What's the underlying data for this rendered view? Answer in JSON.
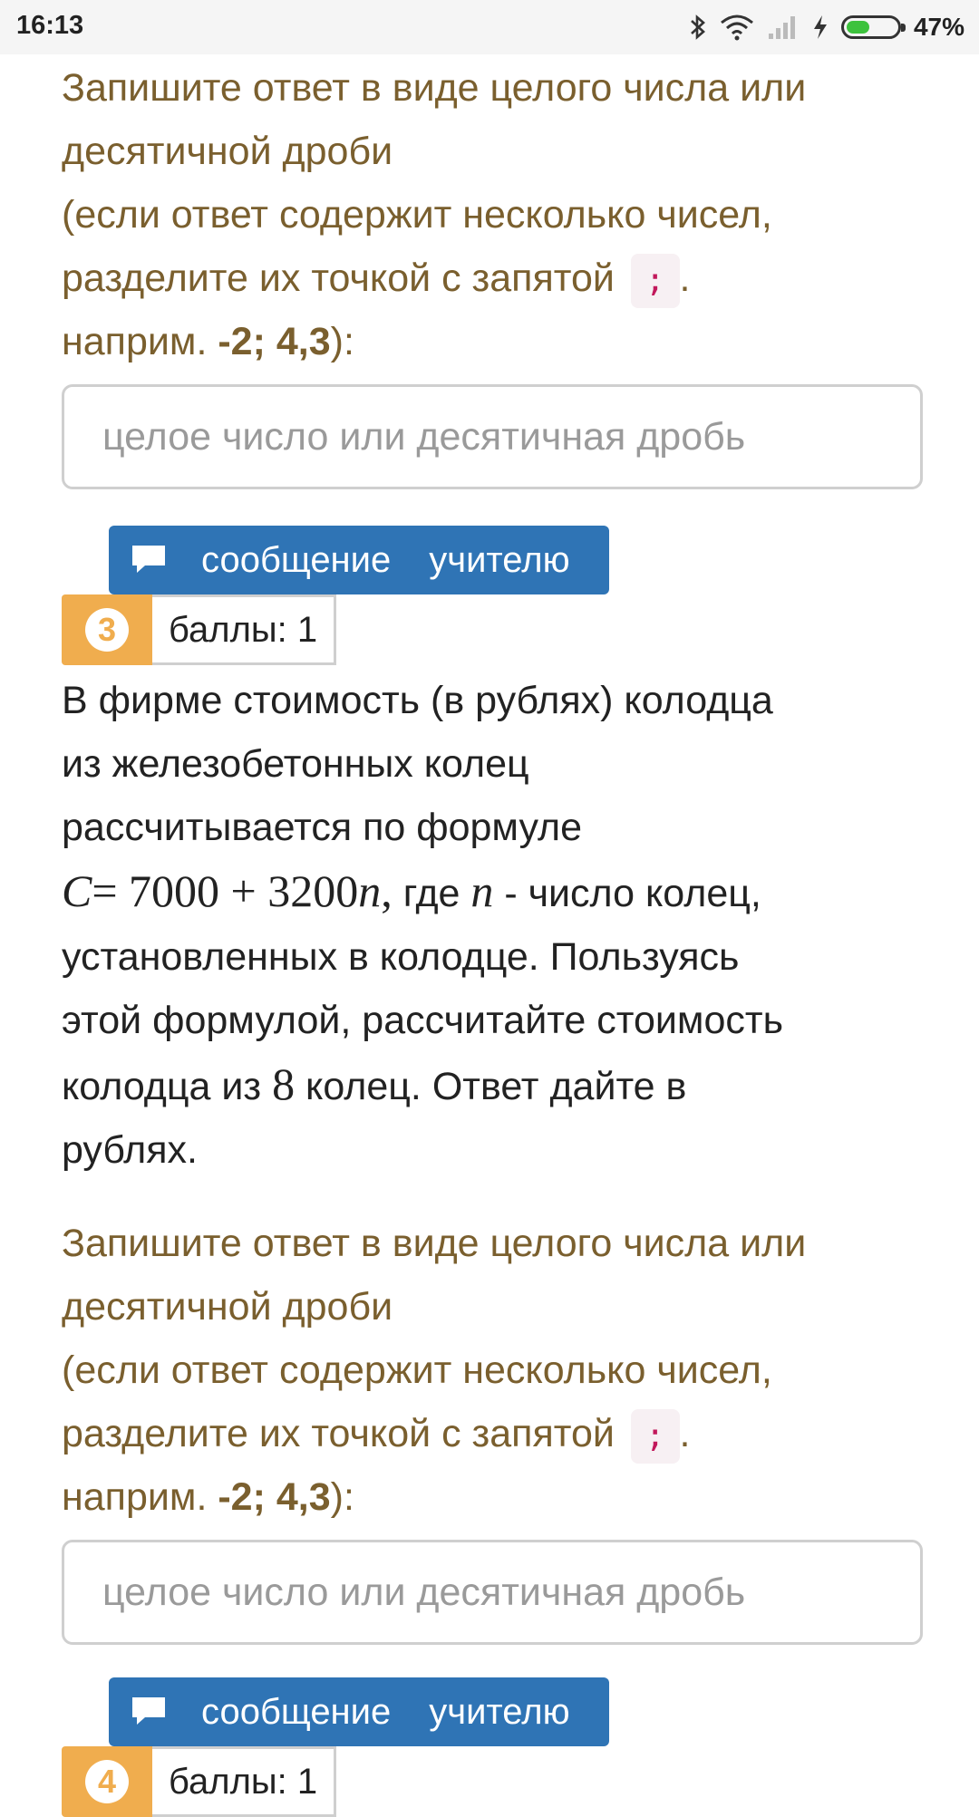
{
  "status_bar": {
    "time": "16:13",
    "battery_percent": "47%",
    "battery_level": 0.47,
    "icons": [
      "bluetooth-icon",
      "wifi-icon",
      "signal-icon",
      "charging-icon",
      "battery-icon"
    ]
  },
  "block_top": {
    "instr_line1": "Запишите ответ в виде целого числа или",
    "instr_line2": "десятичной дроби",
    "instr_line3": "(если ответ содержит несколько чисел,",
    "instr_line4": "разделите их точкой с запятой",
    "separator_code": ";",
    "instr_line4_end": ".",
    "example_prefix": "наприм.",
    "example_value": "-2; 4,3",
    "example_suffix": "):",
    "input_placeholder": "целое число или десятичная дробь",
    "input_value": "",
    "message_button_word1": "сообщение",
    "message_button_word2": "учителю"
  },
  "question3": {
    "number": "3",
    "score_label": "баллы: 1",
    "line1": "В фирме стоимость (в рублях) колодца",
    "line2": "из железобетонных колец",
    "line3": "рассчитывается по формуле",
    "formula_c": "C",
    "formula_eq": "= 7000 + 3200",
    "formula_n": "n",
    "formula_comma": ",",
    "line4_text": " где ",
    "var_n": "n",
    "line4_end": " - число колец,",
    "line5": "установленных в колодце. Пользуясь",
    "line6": "этой формулой, рассчитайте стоимость",
    "line7_start": "колодца из ",
    "rings_count": "8",
    "line7_end": " колец. Ответ дайте в",
    "line8": "рублях.",
    "instr_line1": "Запишите ответ в виде целого числа или",
    "instr_line2": "десятичной дроби",
    "instr_line3": "(если ответ содержит несколько чисел,",
    "instr_line4": "разделите их точкой с запятой",
    "separator_code": ";",
    "instr_line4_end": ".",
    "example_prefix": "наприм.",
    "example_value": "-2; 4,3",
    "example_suffix": "):",
    "input_placeholder": "целое число или десятичная дробь",
    "input_value": "",
    "message_button_word1": "сообщение",
    "message_button_word2": "учителю"
  },
  "question4": {
    "number": "4",
    "score_label": "баллы: 1"
  },
  "colors": {
    "instruction_text": "#7a5f2e",
    "button_blue": "#2f74b5",
    "badge_orange": "#f0ad4e",
    "code_pink": "#c2185b"
  }
}
